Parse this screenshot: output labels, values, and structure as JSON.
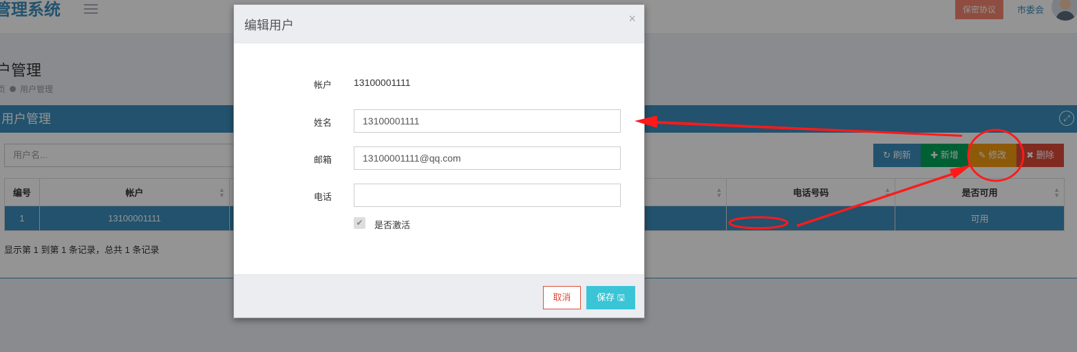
{
  "header": {
    "brand": "管理系统",
    "secret_button": "保密协议",
    "user_name": "市委会"
  },
  "page": {
    "title": "户管理",
    "breadcrumb_prefix": "页",
    "breadcrumb_current": "用户管理"
  },
  "box": {
    "title": "用户管理",
    "search_placeholder": "用户名..."
  },
  "toolbar": {
    "refresh": "刷新",
    "add": "新增",
    "edit": "修改",
    "delete": "删除"
  },
  "table": {
    "columns": [
      "编号",
      "帐户",
      "",
      "电话号码",
      "是否可用"
    ],
    "rows": [
      [
        "1",
        "13100001111",
        "",
        "",
        "可用"
      ]
    ],
    "footer": "显示第 1 到第 1 条记录，总共 1 条记录"
  },
  "modal": {
    "title": "编辑用户",
    "close": "×",
    "account_label": "帐户",
    "account_value": "13100001111",
    "name_label": "姓名",
    "name_value": "13100001111",
    "email_label": "邮箱",
    "email_value": "13100001111@qq.com",
    "phone_label": "电话",
    "phone_value": "",
    "active_label": "是否激活",
    "active_checked": true,
    "cancel": "取消",
    "save": "保存"
  },
  "icons": {
    "refresh": "refresh-icon",
    "add": "plus-icon",
    "edit": "edit-icon",
    "delete": "x-icon",
    "save": "floppy-icon",
    "expand": "expand-icon",
    "sort": "sort-icon",
    "menu": "hamburger-icon",
    "check": "check-icon"
  },
  "colors": {
    "primary": "#3c8dbc",
    "success": "#00a65a",
    "warning": "#f39c12",
    "danger": "#dd4b39",
    "save": "#39c5d6",
    "annotation": "#ff1a1a"
  }
}
